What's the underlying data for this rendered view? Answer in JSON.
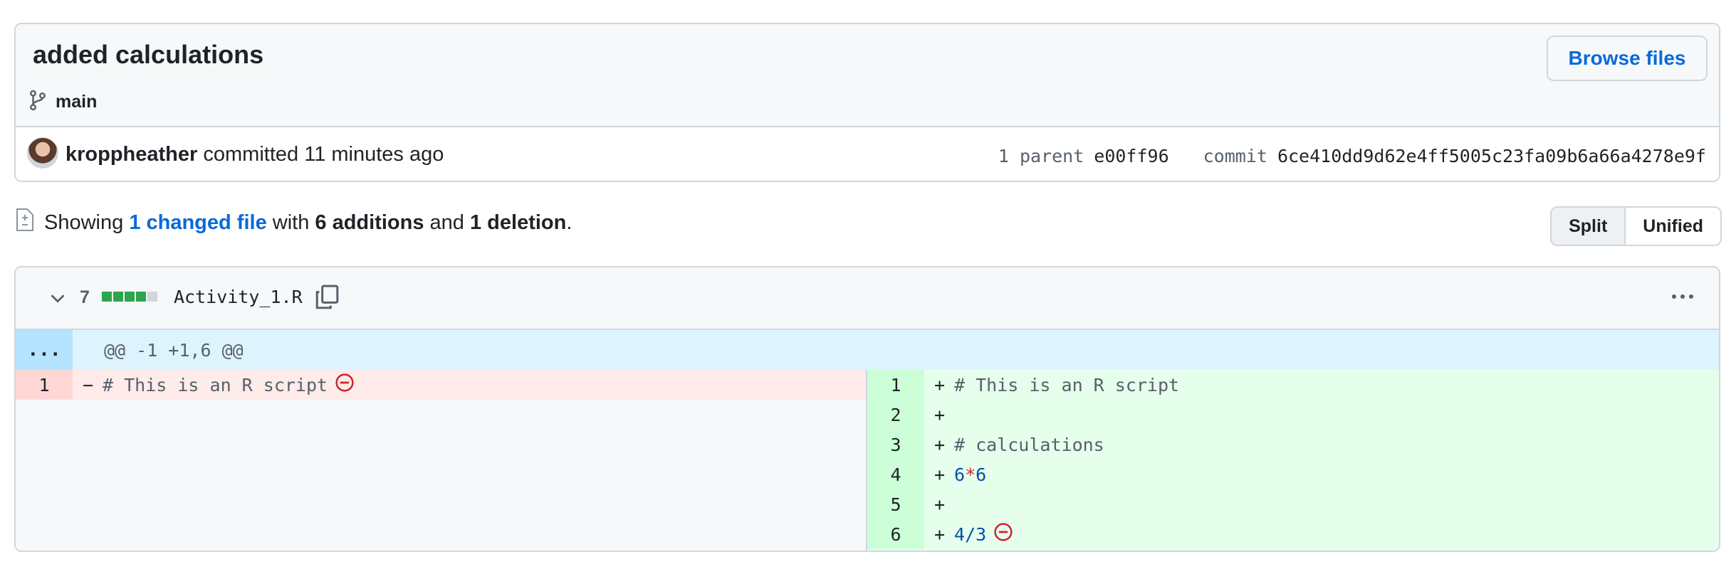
{
  "commit": {
    "title": "added calculations",
    "branch": "main",
    "browse_label": "Browse files",
    "author": "kroppheather",
    "action": "committed",
    "time": "11 minutes ago",
    "parent_label": "1 parent",
    "parent_sha": "e00ff96",
    "commit_label": "commit",
    "commit_sha": "6ce410dd9d62e4ff5005c23fa09b6a66a4278e9f"
  },
  "summary": {
    "prefix": "Showing",
    "changed": "1 changed file",
    "with": "with",
    "additions": "6 additions",
    "and": "and",
    "deletions": "1 deletion",
    "end": "."
  },
  "view_toggle": {
    "split": "Split",
    "unified": "Unified",
    "active": "Split"
  },
  "file": {
    "change_count": "7",
    "diffstat": {
      "added_blocks": 4,
      "removed_blocks": 0,
      "neutral_blocks": 1
    },
    "name": "Activity_1.R",
    "hunk_expand": "...",
    "hunk_header": "@@ -1 +1,6 @@",
    "left": [
      {
        "num": "1",
        "marker": "−",
        "code": "# This is an R script"
      }
    ],
    "right": [
      {
        "num": "1",
        "marker": "+",
        "code": "# This is an R script"
      },
      {
        "num": "2",
        "marker": "+",
        "code": ""
      },
      {
        "num": "3",
        "marker": "+",
        "code": "# calculations"
      },
      {
        "num": "4",
        "marker": "+",
        "a": "6",
        "op": "*",
        "b": "6"
      },
      {
        "num": "5",
        "marker": "+",
        "code": ""
      },
      {
        "num": "6",
        "marker": "+",
        "a": "4",
        "op": "/",
        "b": "3"
      }
    ]
  },
  "colors": {
    "accent": "#0969da",
    "deleted_bg": "#ffebe9",
    "added_bg": "#e6ffec",
    "hunk_bg": "#ddf4ff",
    "diffstat_green": "#2da44e"
  },
  "icons": [
    "git-branch-icon",
    "avatar",
    "file-diff-icon",
    "chevron-down-icon",
    "copy-icon",
    "kebab-icon",
    "no-newline-icon"
  ]
}
